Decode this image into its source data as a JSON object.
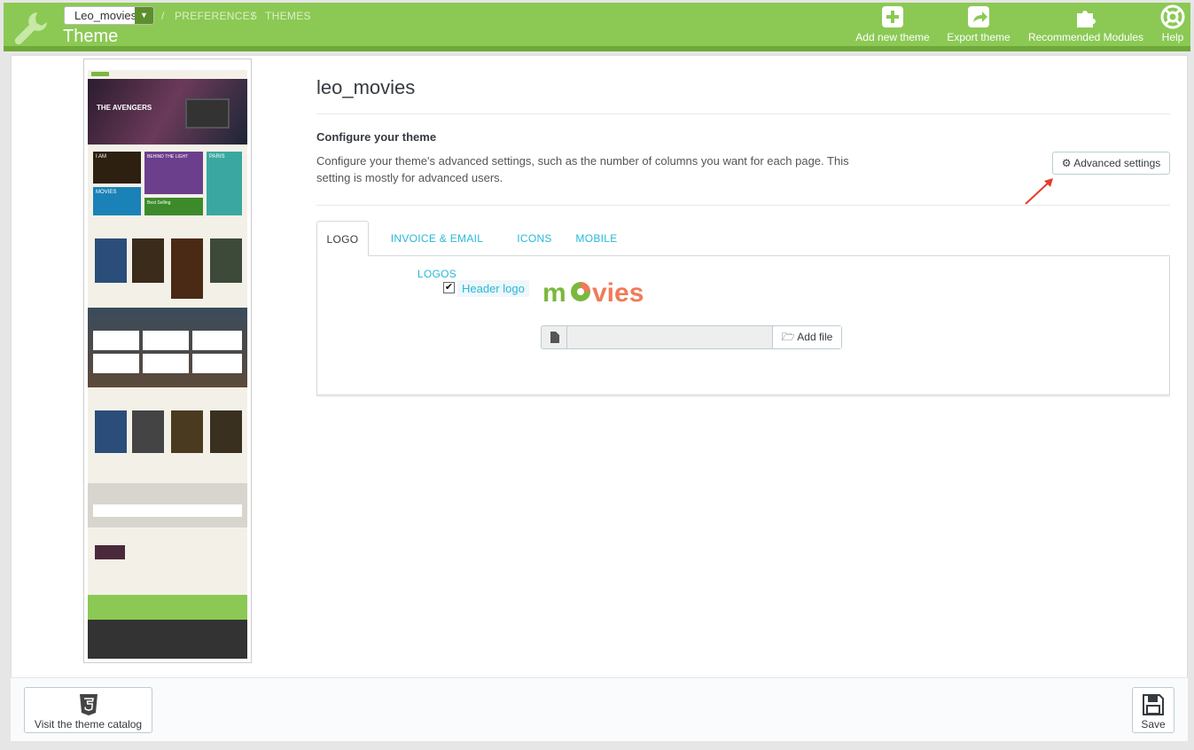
{
  "header": {
    "theme_select_value": "Leo_movies",
    "breadcrumb": [
      "PREFERENCES",
      "THEMES"
    ],
    "page_title": "Theme",
    "toolbar": [
      {
        "label": "Add new theme",
        "icon": "plus-square-icon"
      },
      {
        "label": "Export theme",
        "icon": "share-icon"
      },
      {
        "label": "Recommended Modules",
        "icon": "puzzle-icon"
      },
      {
        "label": "Help",
        "icon": "lifebuoy-icon"
      }
    ]
  },
  "main": {
    "theme_name": "leo_movies",
    "configure_title": "Configure your theme",
    "configure_desc": "Configure your theme's advanced settings, such as the number of columns you want for each page. This setting is mostly for advanced users.",
    "advanced_button": "Advanced settings",
    "tabs": [
      {
        "label": "LOGO",
        "active": true
      },
      {
        "label": "INVOICE & EMAIL LOGOS",
        "active": false
      },
      {
        "label": "ICONS",
        "active": false
      },
      {
        "label": "MOBILE",
        "active": false
      }
    ],
    "header_logo_label": "Header logo",
    "header_logo_checked": true,
    "logo_text": "mOvies",
    "add_file_button": "Add file"
  },
  "thumbnail": {
    "banner_title": "THE AVENGERS",
    "promo_1": "I AM",
    "promo_2": "BEHIND THE LIGHT",
    "promo_3": "PARIS",
    "promo_4": "MOVIES",
    "promo_5": "Best Selling"
  },
  "footer": {
    "catalog_button": "Visit the theme catalog",
    "save_button": "Save"
  },
  "colors": {
    "header_green": "#8bc954",
    "link_blue": "#25b9d7",
    "logo_green": "#7ab83e",
    "logo_orange": "#ef7b5a"
  }
}
